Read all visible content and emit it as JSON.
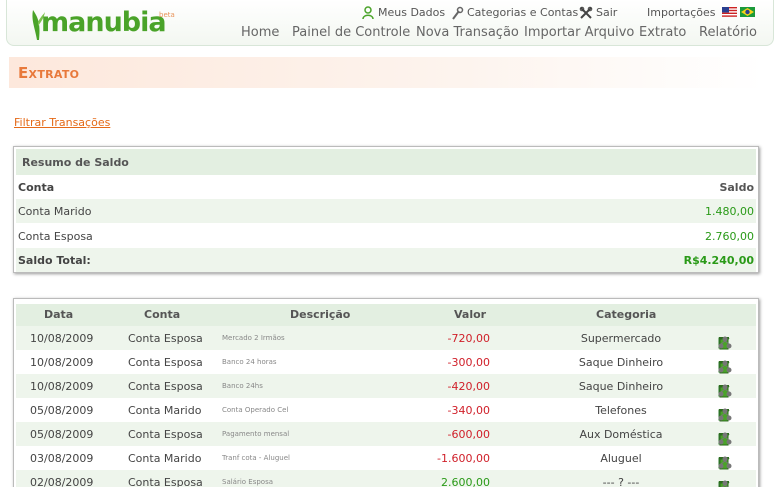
{
  "brand": {
    "name": "manubia",
    "tag": "beta"
  },
  "toplinks": {
    "meus_dados": "Meus Dados",
    "categorias": "Categorias e Contas",
    "sair": "Sair",
    "importacoes": "Importações"
  },
  "nav": [
    "Home",
    "Painel de Controle",
    "Nova Transação",
    "Importar Arquivo",
    "Extrato",
    "Relatório"
  ],
  "page": {
    "title": "Extrato",
    "filter_link": "Filtrar Transações"
  },
  "balance": {
    "heading": "Resumo de Saldo",
    "col_account": "Conta",
    "col_balance": "Saldo",
    "rows": [
      {
        "account": "Conta Marido",
        "value": "1.480,00"
      },
      {
        "account": "Conta Esposa",
        "value": "2.760,00"
      }
    ],
    "total_label": "Saldo Total:",
    "total_value": "R$4.240,00"
  },
  "transactions": {
    "headers": {
      "date": "Data",
      "account": "Conta",
      "description": "Descrição",
      "value": "Valor",
      "category": "Categoria"
    },
    "rows": [
      {
        "date": "10/08/2009",
        "account": "Conta Esposa",
        "description": "Mercado 2 Irmãos",
        "value": "-720,00",
        "category": "Supermercado"
      },
      {
        "date": "10/08/2009",
        "account": "Conta Esposa",
        "description": "Banco 24 horas",
        "value": "-300,00",
        "category": "Saque Dinheiro"
      },
      {
        "date": "10/08/2009",
        "account": "Conta Esposa",
        "description": "Banco 24hs",
        "value": "-420,00",
        "category": "Saque Dinheiro"
      },
      {
        "date": "05/08/2009",
        "account": "Conta Marido",
        "description": "Conta Operado Cel",
        "value": "-340,00",
        "category": "Telefones"
      },
      {
        "date": "05/08/2009",
        "account": "Conta Esposa",
        "description": "Pagamento mensal",
        "value": "-600,00",
        "category": "Aux Doméstica"
      },
      {
        "date": "03/08/2009",
        "account": "Conta Marido",
        "description": "Tranf cota - Aluguel",
        "value": "-1.600,00",
        "category": "Aluguel"
      },
      {
        "date": "02/08/2009",
        "account": "Conta Esposa",
        "description": "Salário Esposa",
        "value": "2.600,00",
        "category": "--- ? ---"
      }
    ]
  },
  "icons": {
    "user": "user-icon",
    "wrench": "wrench-icon",
    "exit": "exit-icon",
    "flag_us": "us-flag-icon",
    "flag_br": "br-flag-icon",
    "edit": "edit-icon",
    "delete": "trash-icon",
    "split": "split-icon"
  },
  "colors": {
    "brand_green": "#4aa329",
    "accent_orange": "#e8793b",
    "negative": "#d0202a",
    "positive": "#2a9a18",
    "header_green": "#e3efe1"
  }
}
